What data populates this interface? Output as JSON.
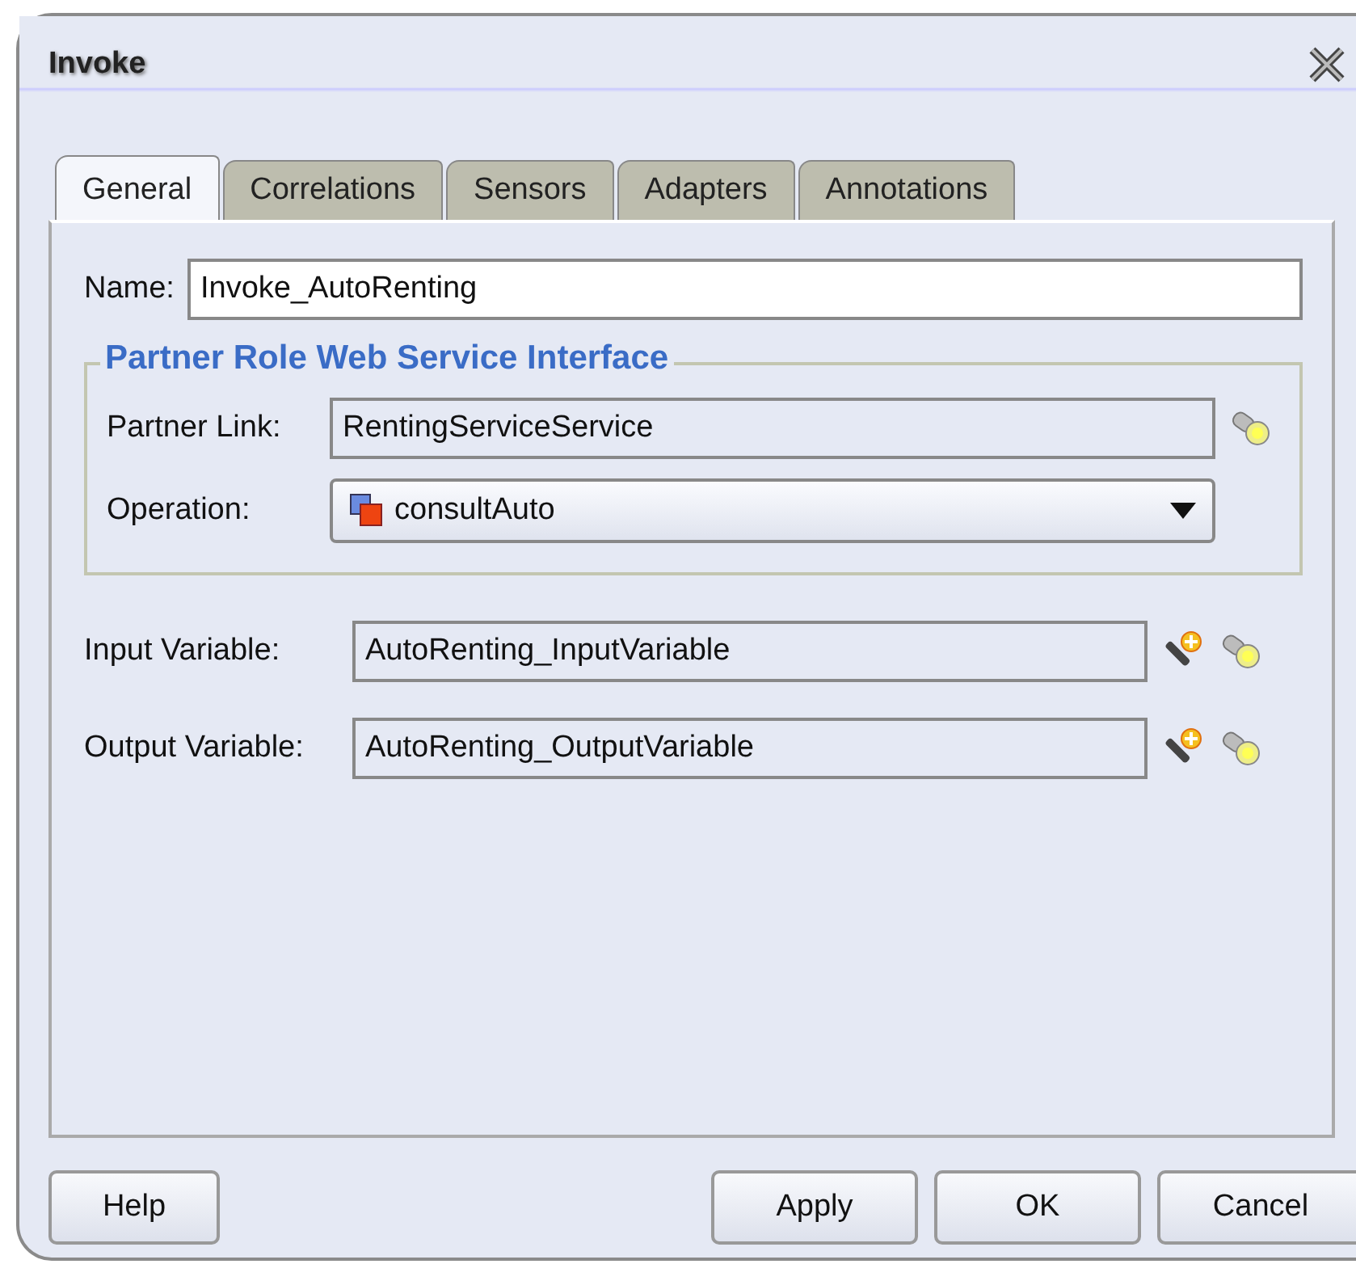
{
  "window": {
    "title": "Invoke"
  },
  "tabs": [
    {
      "label": "General",
      "selected": true
    },
    {
      "label": "Correlations",
      "selected": false
    },
    {
      "label": "Sensors",
      "selected": false
    },
    {
      "label": "Adapters",
      "selected": false
    },
    {
      "label": "Annotations",
      "selected": false
    }
  ],
  "name": {
    "label": "Name:",
    "value": "Invoke_AutoRenting"
  },
  "partner_group": {
    "title": "Partner Role Web Service Interface",
    "partner_link": {
      "label": "Partner Link:",
      "value": "RentingServiceService"
    },
    "operation": {
      "label": "Operation:",
      "value": "consultAuto"
    }
  },
  "variables": [
    {
      "label": "Input Variable:",
      "value": "AutoRenting_InputVariable"
    },
    {
      "label": "Output Variable:",
      "value": "AutoRenting_OutputVariable"
    }
  ],
  "buttons": [
    {
      "label": "Help",
      "kind": "left"
    },
    {
      "label": "Apply",
      "kind": "right"
    },
    {
      "label": "OK",
      "kind": "right"
    },
    {
      "label": "Cancel",
      "kind": "right"
    }
  ]
}
